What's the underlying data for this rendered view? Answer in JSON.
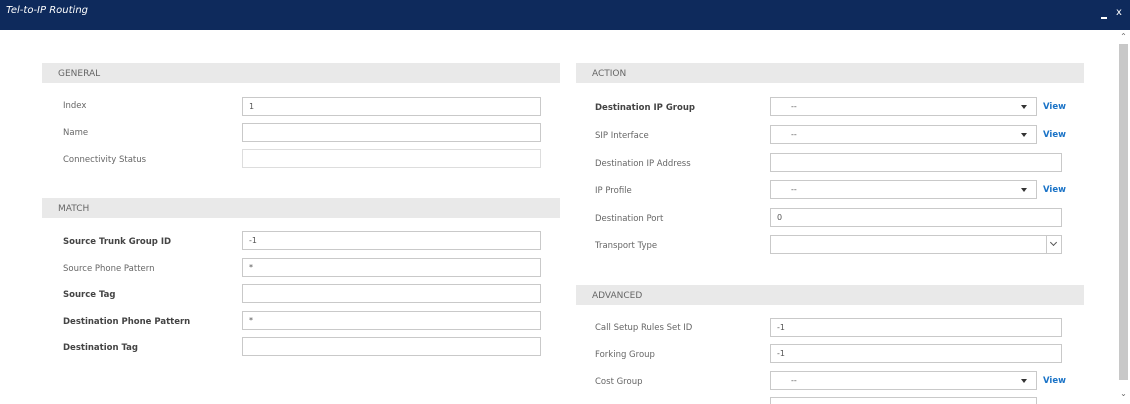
{
  "window": {
    "title": "Tel-to-IP Routing",
    "minimize_icon": "minimize-icon",
    "close_label": "x"
  },
  "sections": {
    "general": "GENERAL",
    "match": "MATCH",
    "action": "ACTION",
    "advanced": "ADVANCED"
  },
  "general": {
    "index": {
      "label": "Index",
      "value": "1"
    },
    "name": {
      "label": "Name",
      "value": ""
    },
    "connectivity_status": {
      "label": "Connectivity Status",
      "value": ""
    }
  },
  "match": {
    "source_trunk_group_id": {
      "label": "Source Trunk Group ID",
      "value": "-1"
    },
    "source_phone_pattern": {
      "label": "Source Phone Pattern",
      "value": "*"
    },
    "source_tag": {
      "label": "Source Tag",
      "value": ""
    },
    "destination_phone_pattern": {
      "label": "Destination Phone Pattern",
      "value": "*"
    },
    "destination_tag": {
      "label": "Destination Tag",
      "value": ""
    }
  },
  "action": {
    "destination_ip_group": {
      "label": "Destination IP Group",
      "value": "--",
      "link": "View"
    },
    "sip_interface": {
      "label": "SIP Interface",
      "value": "--",
      "link": "View"
    },
    "destination_ip_address": {
      "label": "Destination IP Address",
      "value": ""
    },
    "ip_profile": {
      "label": "IP Profile",
      "value": "--",
      "link": "View"
    },
    "destination_port": {
      "label": "Destination Port",
      "value": "0"
    },
    "transport_type": {
      "label": "Transport Type",
      "value": ""
    }
  },
  "advanced": {
    "call_setup_rules_set_id": {
      "label": "Call Setup Rules Set ID",
      "value": "-1"
    },
    "forking_group": {
      "label": "Forking Group",
      "value": "-1"
    },
    "cost_group": {
      "label": "Cost Group",
      "value": "--",
      "link": "View"
    }
  },
  "scrollbar": {
    "up_icon": "chevron-up-icon",
    "down_icon": "chevron-down-icon"
  }
}
